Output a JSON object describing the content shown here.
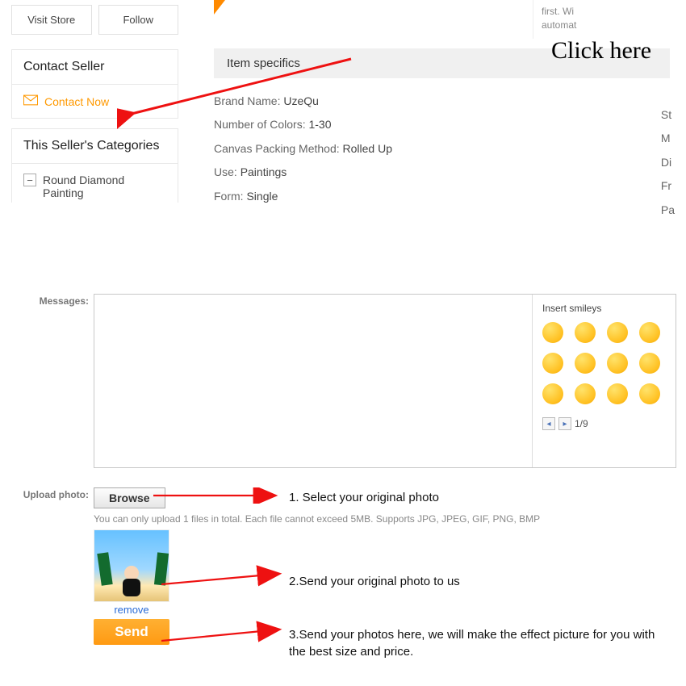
{
  "sidebar": {
    "visit_store": "Visit Store",
    "follow": "Follow",
    "contact_seller_header": "Contact Seller",
    "contact_now": "Contact Now",
    "categories_header": "This Seller's Categories",
    "cat0": "Round Diamond Painting"
  },
  "top_right": {
    "line1": "first. Wi",
    "line2": "automat"
  },
  "specs": {
    "header": "Item specifics",
    "brand_label": "Brand Name:",
    "brand_val": "UzeQu",
    "colors_label": "Number of Colors:",
    "colors_val": "1-30",
    "canvas_label": "Canvas Packing Method:",
    "canvas_val": "Rolled Up",
    "use_label": "Use:",
    "use_val": "Paintings",
    "form_label": "Form:",
    "form_val": "Single",
    "r0": "St",
    "r1": "M",
    "r2": "Di",
    "r3": "Fr",
    "r4": "Pa"
  },
  "annotation": {
    "click_here": "Click here"
  },
  "messages": {
    "label": "Messages:",
    "smiley_title": "Insert smileys",
    "pager": "1/9"
  },
  "upload": {
    "label": "Upload photo:",
    "browse": "Browse",
    "hint": "You can only upload 1 files in total. Each file cannot exceed 5MB. Supports JPG, JPEG, GIF, PNG, BMP",
    "remove": "remove",
    "send": "Send"
  },
  "instructions": {
    "i1": "1. Select your original photo",
    "i2": "2.Send your original photo to us",
    "i3a": "3.Send your photos here, we will make the effect picture for you with",
    "i3b": " the best size and price."
  }
}
